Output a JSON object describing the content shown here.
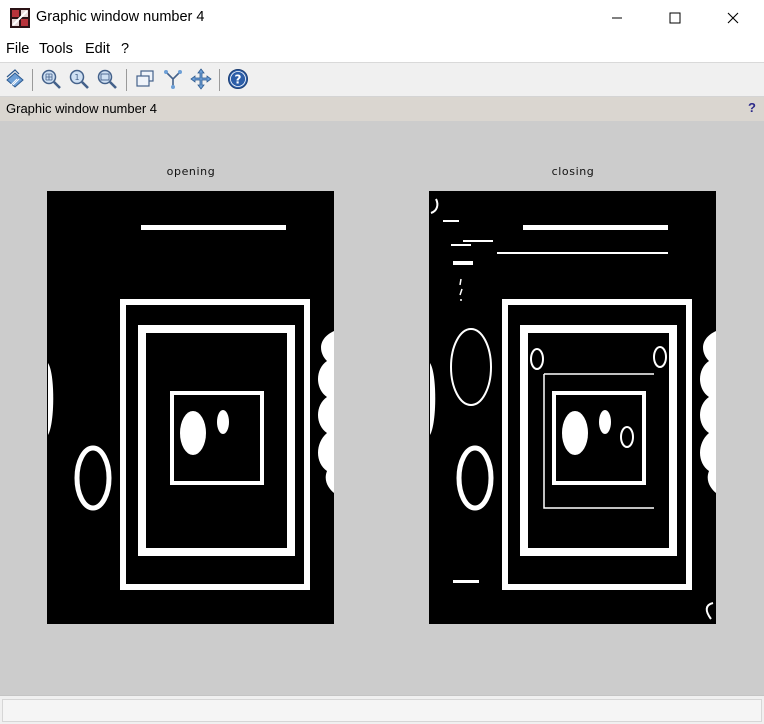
{
  "window": {
    "title": "Graphic window number 4",
    "controls": [
      "minimize-icon",
      "maximize-icon",
      "close-icon"
    ]
  },
  "menu": {
    "file": "File",
    "tools": "Tools",
    "edit": "Edit",
    "help": "?"
  },
  "toolbar": {
    "icons": [
      "rotate-2d-3d-icon",
      "zoom-icon",
      "unzoom-icon",
      "zoom-out-icon",
      "datatip-icon",
      "datatip-edit-icon",
      "move-icon",
      "help-icon"
    ]
  },
  "info_bar": {
    "text": "Graphic window number 4",
    "help": "?"
  },
  "plots": [
    {
      "title": "opening"
    },
    {
      "title": "closing"
    }
  ],
  "colors": {
    "canvas": "#cccccc",
    "image_background": "#000000",
    "image_foreground": "#ffffff",
    "help_icon": "#2d5ea8"
  },
  "status_bar": {
    "text": ""
  }
}
